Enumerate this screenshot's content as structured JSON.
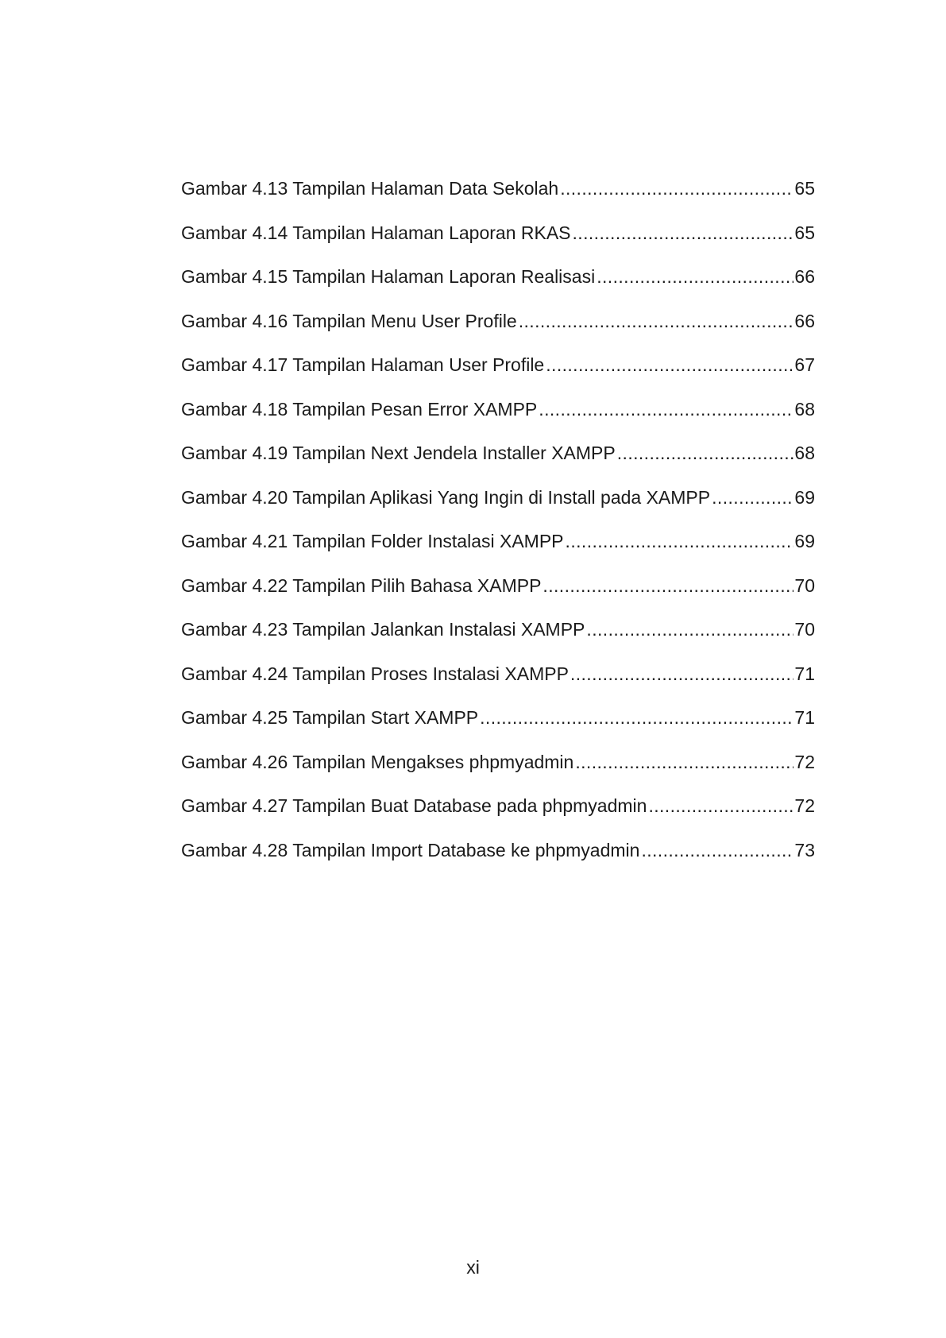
{
  "toc": {
    "entries": [
      {
        "title": "Gambar 4.13 Tampilan Halaman Data Sekolah",
        "page": "65"
      },
      {
        "title": "Gambar 4.14 Tampilan Halaman Laporan RKAS",
        "page": "65"
      },
      {
        "title": "Gambar 4.15 Tampilan Halaman Laporan Realisasi",
        "page": "66"
      },
      {
        "title": "Gambar 4.16 Tampilan Menu User Profile",
        "page": "66"
      },
      {
        "title": "Gambar 4.17 Tampilan Halaman User Profile",
        "page": "67"
      },
      {
        "title": "Gambar 4.18 Tampilan Pesan Error XAMPP",
        "page": "68"
      },
      {
        "title": "Gambar 4.19 Tampilan Next Jendela Installer XAMPP",
        "page": "68"
      },
      {
        "title": "Gambar 4.20 Tampilan Aplikasi Yang Ingin di Install pada XAMPP",
        "page": "69"
      },
      {
        "title": "Gambar 4.21 Tampilan Folder Instalasi XAMPP",
        "page": "69"
      },
      {
        "title": "Gambar 4.22 Tampilan Pilih Bahasa XAMPP",
        "page": "70"
      },
      {
        "title": "Gambar 4.23 Tampilan Jalankan Instalasi XAMPP",
        "page": "70"
      },
      {
        "title": "Gambar 4.24 Tampilan Proses Instalasi XAMPP",
        "page": "71"
      },
      {
        "title": "Gambar 4.25 Tampilan Start XAMPP",
        "page": "71"
      },
      {
        "title": "Gambar 4.26 Tampilan Mengakses phpmyadmin",
        "page": "72"
      },
      {
        "title": "Gambar 4.27 Tampilan Buat Database pada phpmyadmin",
        "page": "72"
      },
      {
        "title": "Gambar 4.28 Tampilan Import Database ke phpmyadmin",
        "page": "73"
      }
    ]
  },
  "footer": {
    "page_number": "xi"
  }
}
